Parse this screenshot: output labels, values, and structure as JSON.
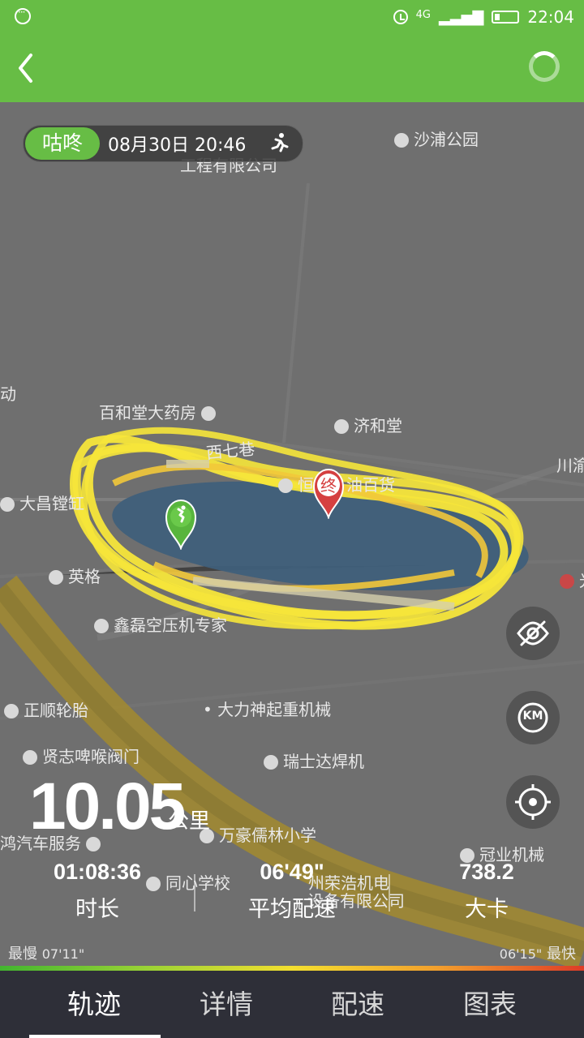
{
  "status_bar": {
    "network": "4G",
    "time": "22:04",
    "icons": [
      "menu-dots-icon",
      "alarm-icon",
      "signal-icon",
      "battery-icon"
    ]
  },
  "app_bar": {
    "back_icon": "chevron-left-icon",
    "loading_icon": "spinner-icon"
  },
  "session": {
    "brand": "咕咚",
    "datetime": "08月30日 20:46",
    "activity_icon": "runner-icon"
  },
  "map_labels": [
    "工程有限公司",
    "沙浦公园",
    "动",
    "百和堂大药房",
    "济和堂",
    "西七巷",
    "川渝",
    "大昌镗缸",
    "恒",
    "油百货",
    "英格",
    "鑫磊空压机专家",
    "正顺轮胎",
    "大力神起重机械",
    "贤志啤喉阀门",
    "瑞士达焊机",
    "万豪儒林小学",
    "鸿汽车服务",
    "同心学校",
    "冠业机械",
    "州荣浩机电",
    "设备有限公司",
    "光"
  ],
  "markers": {
    "start_icon": "start-runner-marker-icon",
    "end_label": "终"
  },
  "side_buttons": {
    "hide": "eye-off-icon",
    "km": "KM",
    "locate": "crosshair-icon"
  },
  "stats": {
    "distance": "10.05",
    "distance_unit": "公里",
    "duration_value": "01:08:36",
    "duration_label": "时长",
    "pace_value": "06'49\"",
    "pace_label": "平均配速",
    "calories_value": "738.2",
    "calories_label": "大卡"
  },
  "pace_scale": {
    "slow_label": "最慢",
    "slow_value": "07'11\"",
    "fast_value": "06'15\"",
    "fast_label": "最快"
  },
  "tabs": [
    {
      "label": "轨迹",
      "active": true
    },
    {
      "label": "详情",
      "active": false
    },
    {
      "label": "配速",
      "active": false
    },
    {
      "label": "图表",
      "active": false
    }
  ],
  "colors": {
    "primary": "#67bd45",
    "track": "#f6e53a",
    "lake": "#3f5f7a",
    "tab_background": "#2e2f38"
  }
}
